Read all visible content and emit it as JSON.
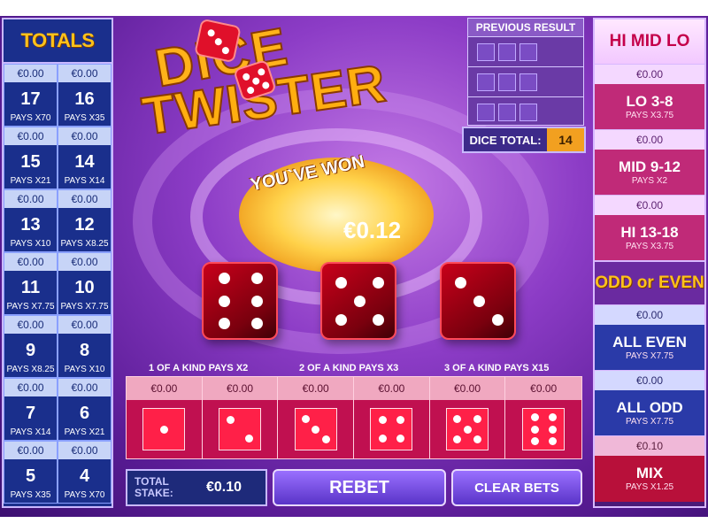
{
  "colors": {
    "accent": "#ffc21a",
    "panel_blue": "#1a2f8c",
    "panel_pink": "#c02a78"
  },
  "totals": {
    "title": "TOTALS",
    "cells": [
      {
        "stake": "€0.00",
        "num": "17",
        "pays": "PAYS X70"
      },
      {
        "stake": "€0.00",
        "num": "16",
        "pays": "PAYS X35"
      },
      {
        "stake": "€0.00",
        "num": "15",
        "pays": "PAYS X21"
      },
      {
        "stake": "€0.00",
        "num": "14",
        "pays": "PAYS X14"
      },
      {
        "stake": "€0.00",
        "num": "13",
        "pays": "PAYS X10"
      },
      {
        "stake": "€0.00",
        "num": "12",
        "pays": "PAYS X8.25"
      },
      {
        "stake": "€0.00",
        "num": "11",
        "pays": "PAYS X7.75"
      },
      {
        "stake": "€0.00",
        "num": "10",
        "pays": "PAYS X7.75"
      },
      {
        "stake": "€0.00",
        "num": "9",
        "pays": "PAYS X8.25"
      },
      {
        "stake": "€0.00",
        "num": "8",
        "pays": "PAYS X10"
      },
      {
        "stake": "€0.00",
        "num": "7",
        "pays": "PAYS X14"
      },
      {
        "stake": "€0.00",
        "num": "6",
        "pays": "PAYS X21"
      },
      {
        "stake": "€0.00",
        "num": "5",
        "pays": "PAYS X35"
      },
      {
        "stake": "€0.00",
        "num": "4",
        "pays": "PAYS X70"
      }
    ]
  },
  "himidlo": {
    "title": "HI MID LO",
    "cells": [
      {
        "stake": "€0.00",
        "label": "LO 3-8",
        "pays": "PAYS X3.75"
      },
      {
        "stake": "€0.00",
        "label": "MID 9-12",
        "pays": "PAYS X2"
      },
      {
        "stake": "€0.00",
        "label": "HI 13-18",
        "pays": "PAYS X3.75"
      }
    ]
  },
  "oddeven": {
    "title": "ODD or EVEN",
    "cells": [
      {
        "stake": "€0.00",
        "label": "ALL EVEN",
        "pays": "PAYS X7.75"
      },
      {
        "stake": "€0.00",
        "label": "ALL ODD",
        "pays": "PAYS X7.75"
      },
      {
        "stake": "€0.10",
        "label": "MIX",
        "pays": "PAYS X1.25"
      }
    ]
  },
  "previous": {
    "title": "PREVIOUS RESULT"
  },
  "dice_total": {
    "label": "DICE TOTAL:",
    "value": "14"
  },
  "logo": {
    "line1": "DICE",
    "line2": "TWISTER"
  },
  "result": {
    "message": "YOU`VE WON",
    "amount": "€0.12"
  },
  "dice_values": [
    6,
    5,
    3
  ],
  "kinds": [
    {
      "label": "1 OF A KIND PAYS X2"
    },
    {
      "label": "2 OF A KIND PAYS X3"
    },
    {
      "label": "3 OF A KIND PAYS X15"
    }
  ],
  "faces": [
    {
      "stake": "€0.00",
      "value": 1
    },
    {
      "stake": "€0.00",
      "value": 2
    },
    {
      "stake": "€0.00",
      "value": 3
    },
    {
      "stake": "€0.00",
      "value": 4
    },
    {
      "stake": "€0.00",
      "value": 5
    },
    {
      "stake": "€0.00",
      "value": 6
    }
  ],
  "controls": {
    "total_stake_label_1": "TOTAL",
    "total_stake_label_2": "STAKE:",
    "total_stake_value": "€0.10",
    "rebet": "REBET",
    "clear_bets": "CLEAR BETS"
  }
}
